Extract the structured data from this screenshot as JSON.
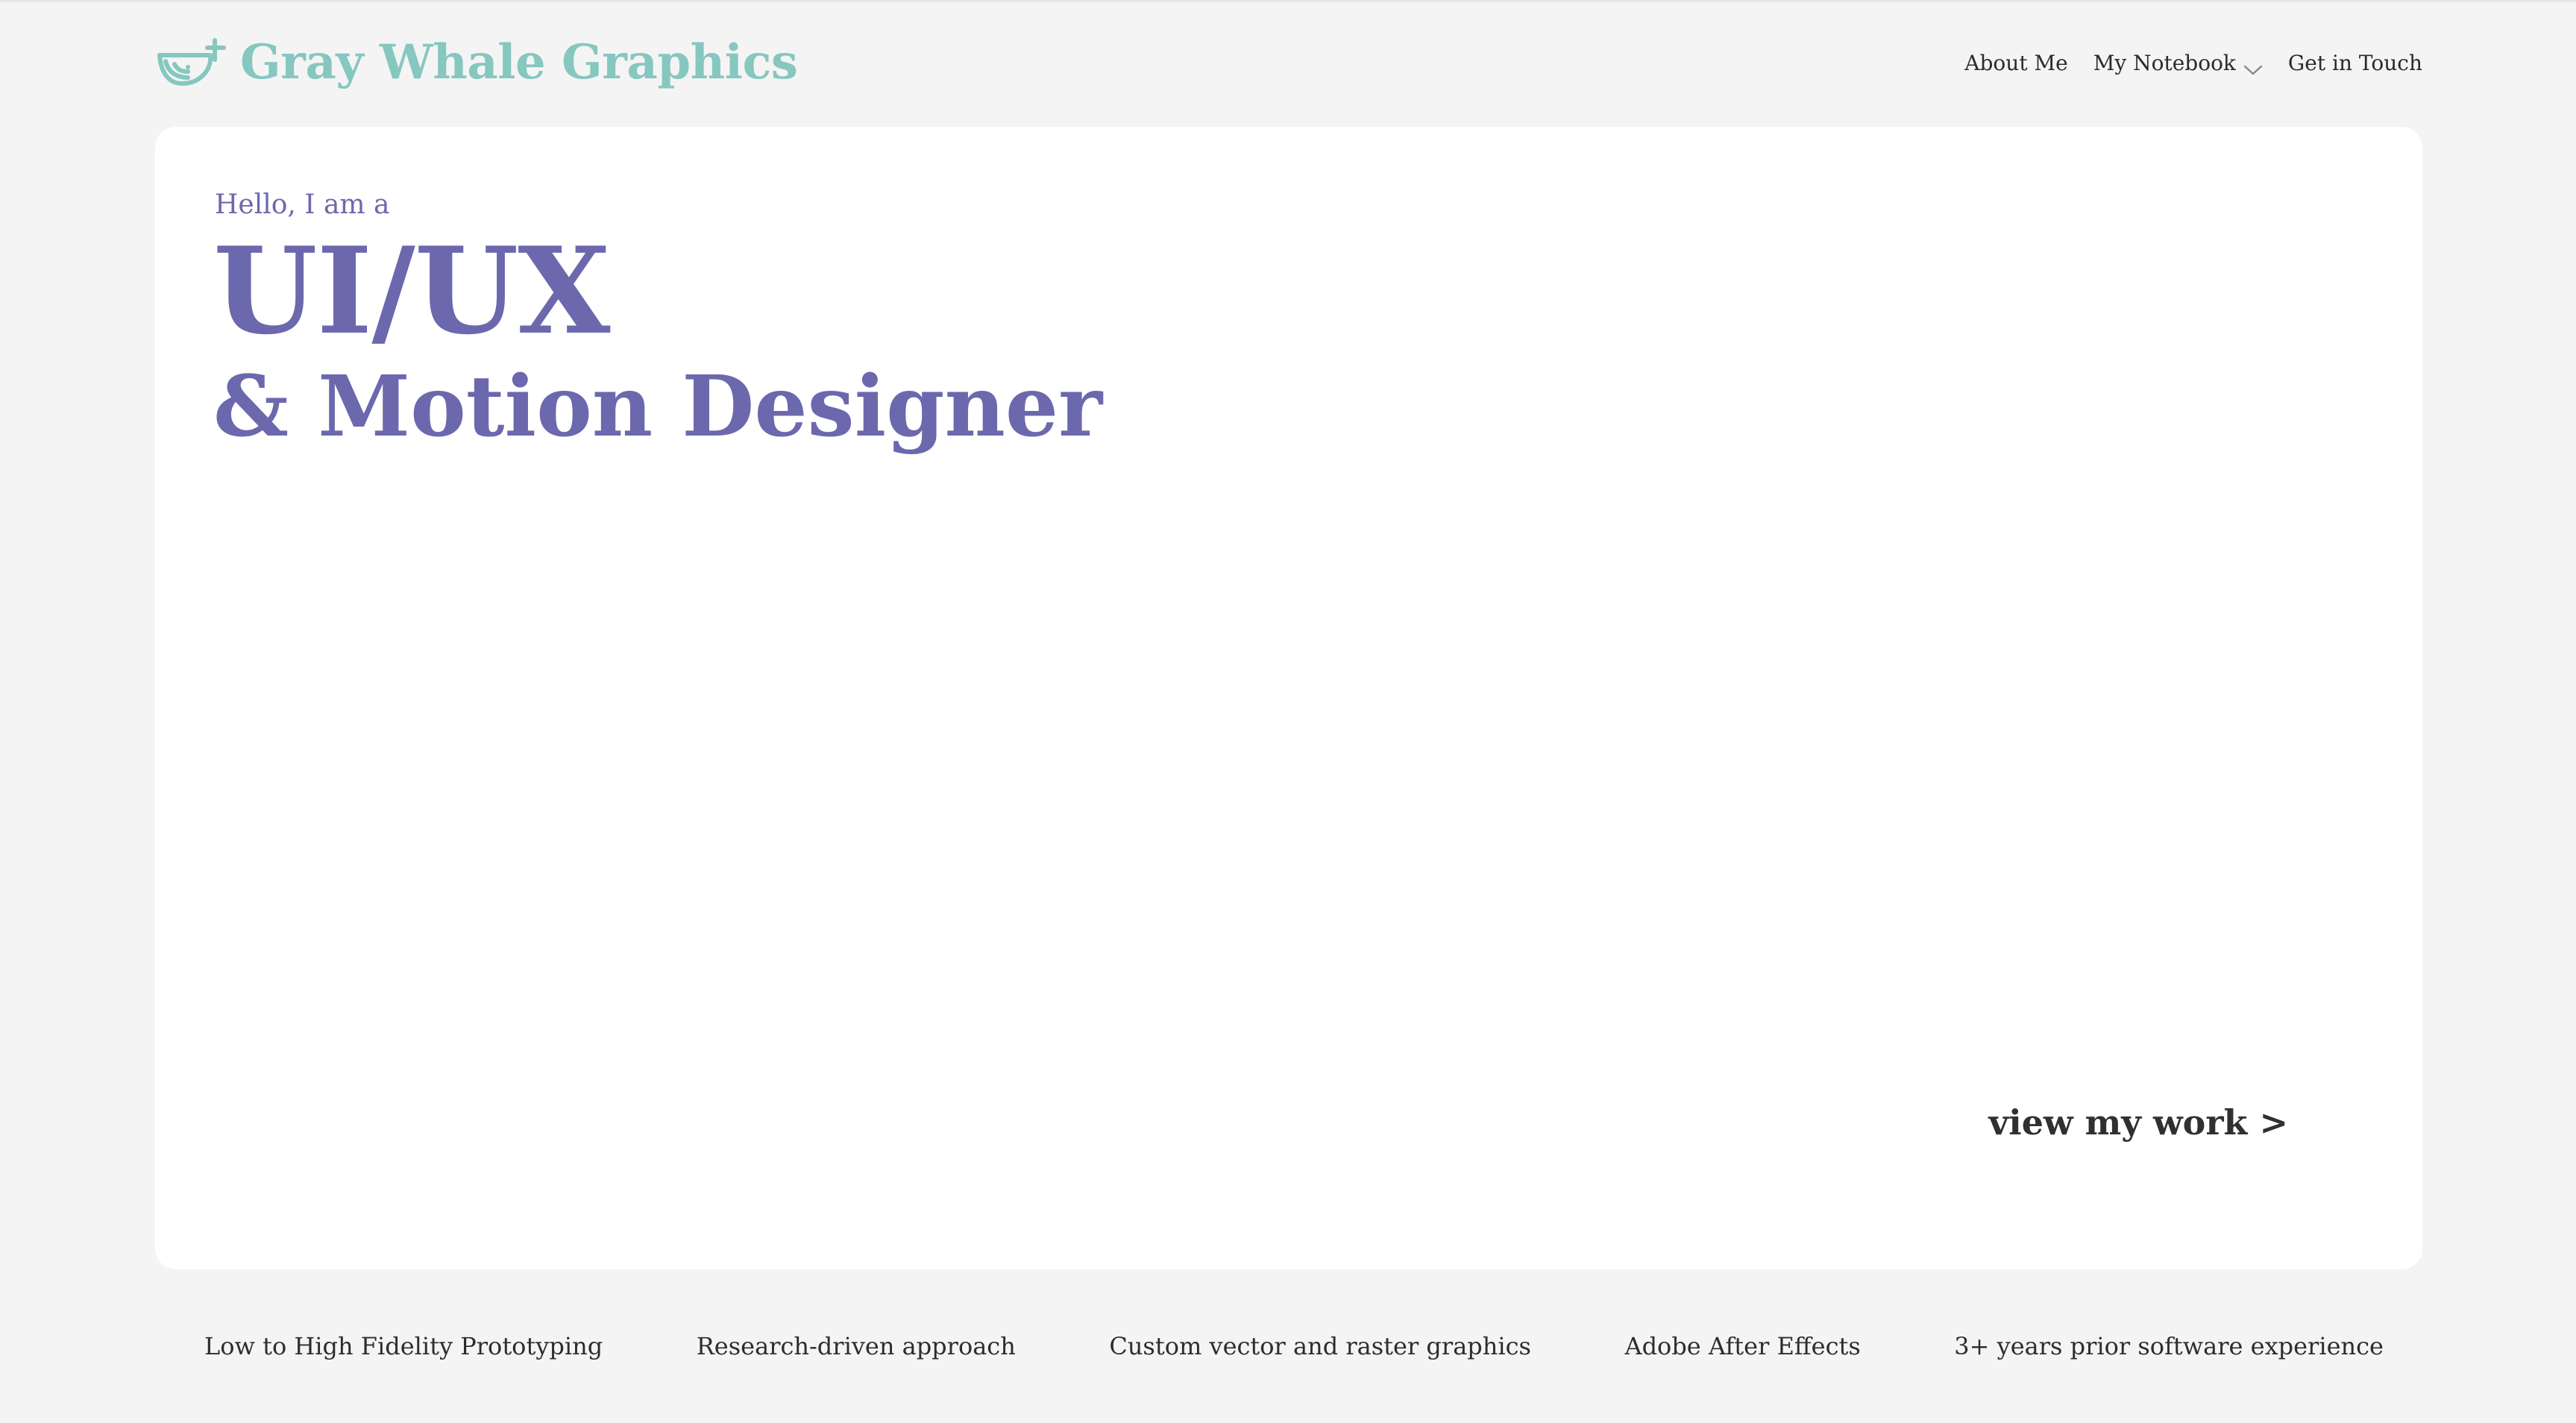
{
  "header": {
    "brand": {
      "name": "Gray Whale Graphics",
      "icon": "whale-logo-icon",
      "color": "#86c7c0"
    },
    "nav": [
      {
        "label": "About Me"
      },
      {
        "label": "My Notebook",
        "has_dropdown": true,
        "icon": "chevron-down-icon"
      },
      {
        "label": "Get in Touch"
      }
    ]
  },
  "hero": {
    "intro": "Hello, I am a",
    "title": "UI/UX",
    "subtitle": "& Motion Designer",
    "cta": "view my work >",
    "accent_color": "#6c68ae"
  },
  "skills": [
    "Low to High Fidelity Prototyping",
    "Research-driven approach",
    "Custom vector and raster graphics",
    "Adobe After Effects",
    "3+ years prior software experience"
  ]
}
